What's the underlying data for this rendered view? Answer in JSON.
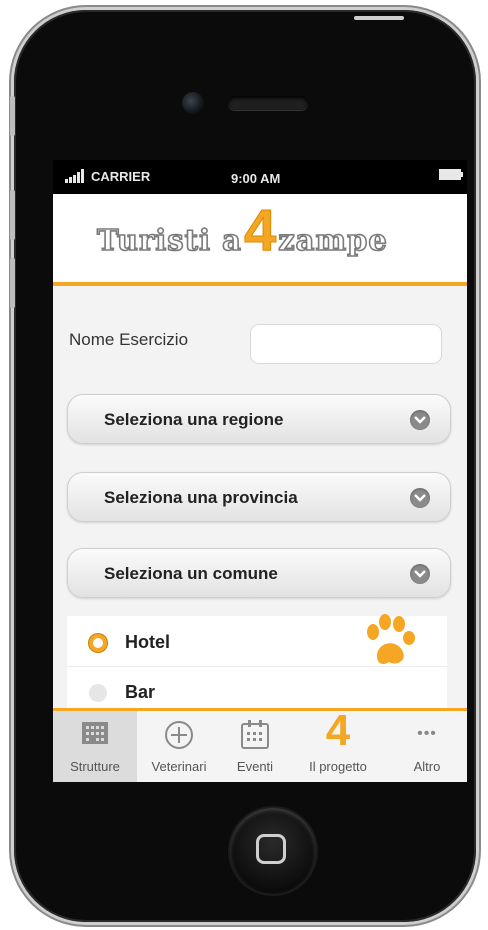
{
  "status": {
    "carrier": "CARRIER",
    "time": "9:00 AM"
  },
  "brand": {
    "word1": "Turisti a",
    "four": "4",
    "word2": "zampe",
    "accent": "#f5a623"
  },
  "form": {
    "name_label": "Nome Esercizio",
    "name_value": "",
    "selects": [
      {
        "label": "Seleziona una regione"
      },
      {
        "label": "Seleziona una provincia"
      },
      {
        "label": "Seleziona un comune"
      }
    ],
    "options": [
      {
        "label": "Hotel",
        "selected": true
      },
      {
        "label": "Bar",
        "selected": false
      }
    ]
  },
  "tabs": [
    {
      "label": "Strutture",
      "icon": "building-icon",
      "active": true
    },
    {
      "label": "Veterinari",
      "icon": "plus-circle-icon",
      "active": false
    },
    {
      "label": "Eventi",
      "icon": "calendar-icon",
      "active": false
    },
    {
      "label": "Il progetto",
      "icon": "four-icon",
      "active": false
    },
    {
      "label": "Altro",
      "icon": "more-icon",
      "active": false
    }
  ]
}
